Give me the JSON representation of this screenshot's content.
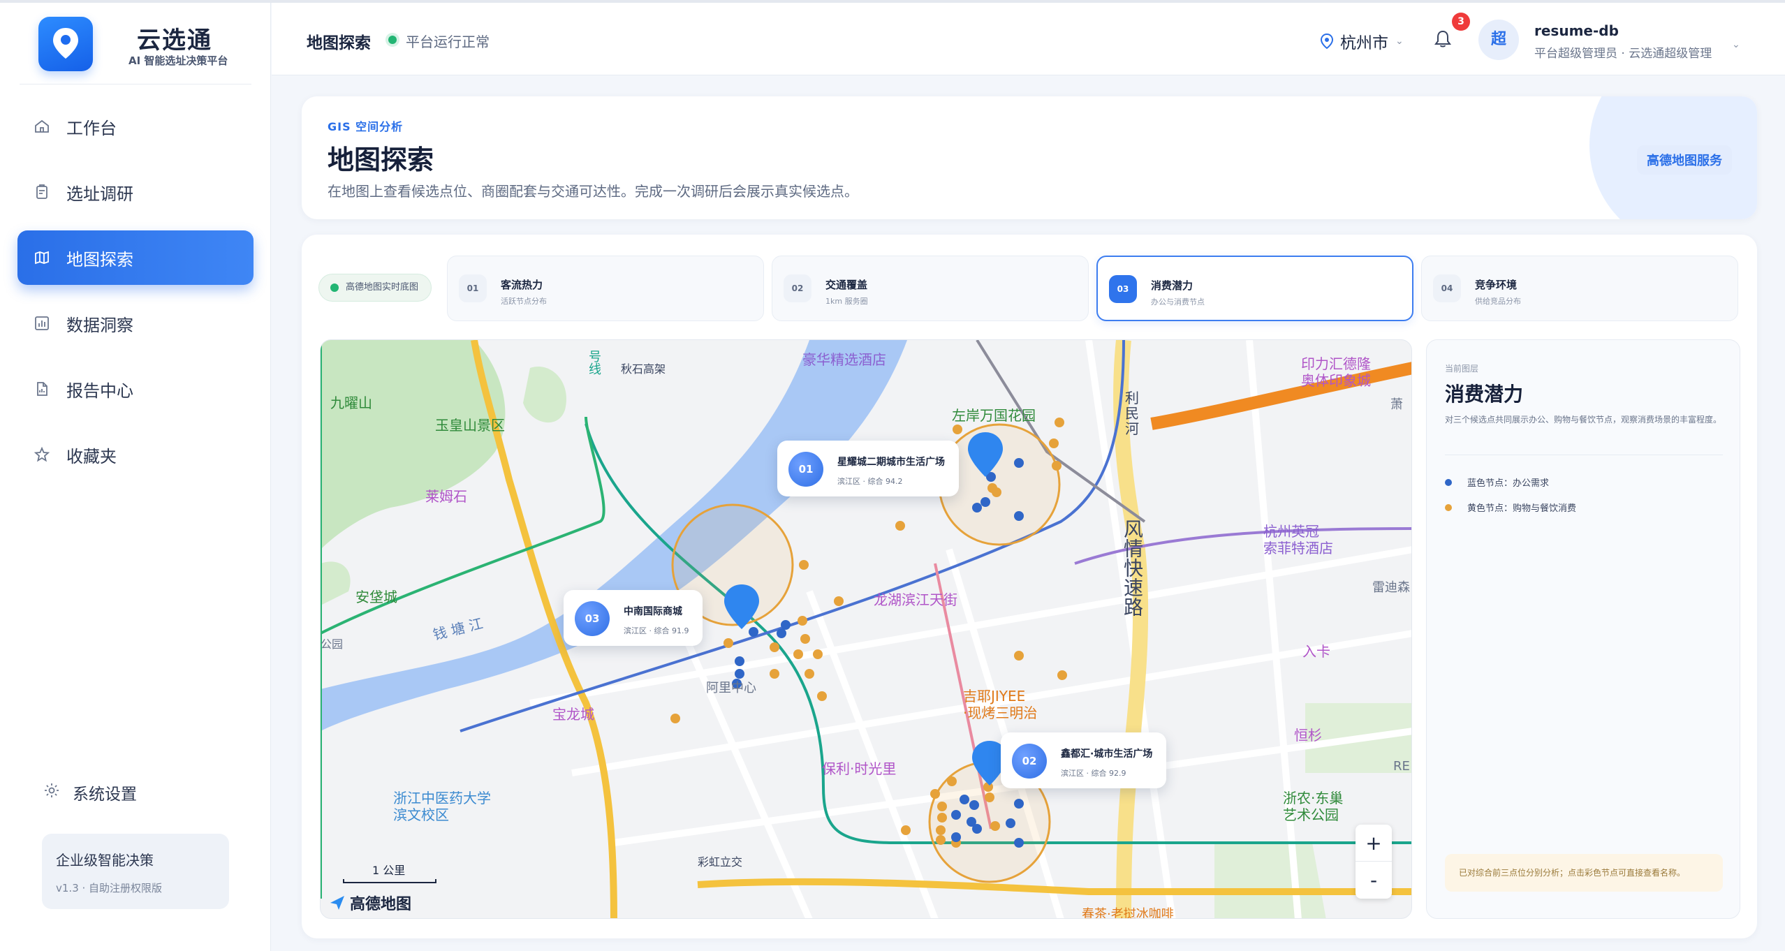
{
  "brand": {
    "name": "云选通",
    "tagline": "AI 智能选址决策平台"
  },
  "sidebar": {
    "items": [
      {
        "label": "工作台",
        "icon": "home-icon",
        "active": false
      },
      {
        "label": "选址调研",
        "icon": "clipboard-icon",
        "active": false
      },
      {
        "label": "地图探索",
        "icon": "map-icon",
        "active": true
      },
      {
        "label": "数据洞察",
        "icon": "bar-chart-icon",
        "active": false
      },
      {
        "label": "报告中心",
        "icon": "document-icon",
        "active": false
      },
      {
        "label": "收藏夹",
        "icon": "star-icon",
        "active": false
      }
    ],
    "settings_label": "系统设置",
    "enterprise": {
      "title": "企业级智能决策",
      "sub": "v1.3 · 自助注册权限版"
    }
  },
  "header": {
    "title": "地图探索",
    "status": "平台运行正常",
    "city": "杭州市",
    "notifications": "3",
    "avatar_text": "超",
    "user_name": "resume-db",
    "user_role": "平台超级管理员 · 云选通超级管理"
  },
  "hero": {
    "kicker": "GIS 空间分析",
    "title": "地图探索",
    "description": "在地图上查看候选点位、商圈配套与交通可达性。完成一次调研后会展示真实候选点。",
    "tag": "高德地图服务"
  },
  "panel": {
    "live_chip": "高德地图实时底图",
    "steps": [
      {
        "num": "01",
        "title": "客流热力",
        "sub": "活跃节点分布",
        "active": false
      },
      {
        "num": "02",
        "title": "交通覆盖",
        "sub": "1km 服务圈",
        "active": false
      },
      {
        "num": "03",
        "title": "消费潜力",
        "sub": "办公与消费节点",
        "active": true
      },
      {
        "num": "04",
        "title": "竞争环境",
        "sub": "供给竞品分布",
        "active": false
      }
    ]
  },
  "map": {
    "candidates": [
      {
        "num": "01",
        "name": "星耀城二期城市生活广场",
        "sub": "滨江区 · 综合 94.2"
      },
      {
        "num": "03",
        "name": "中南国际商城",
        "sub": "滨江区 · 综合 91.9"
      },
      {
        "num": "02",
        "name": "鑫都汇·城市生活广场",
        "sub": "滨江区 · 综合 92.9"
      }
    ],
    "labels": {
      "river": "钱 塘 江",
      "line": "号线",
      "road1": "秋石高架",
      "hotel": "豪华精选酒店",
      "yinli": "印力汇德隆",
      "yinli2": "奥体印象城",
      "xiao": "萧",
      "jiuyao": "九曜山",
      "yuhuang": "玉皇山景区",
      "zuoan": "左岸万国花园",
      "limin1": "利",
      "limin2": "民",
      "limin3": "河",
      "laimu": "莱姆石",
      "fengqing": "风情快速路",
      "hangzhou_ying1": "杭州英冠",
      "hangzhou_ying2": "索菲特酒店",
      "anjie": "安垡城",
      "longhu": "龙湖滨江天街",
      "leidi": "雷迪森",
      "park": "公园",
      "ruka": "入卡",
      "ali": "阿里中心",
      "jiye1": "吉耶JIYEE",
      "jiye2": "·现烤三明治",
      "baolong": "宝龙城",
      "henshan": "恒杉",
      "baoli": "保利·时光里",
      "re": "RE",
      "zhongyi1": "浙江中医药大学",
      "zhongyi2": "滨文校区",
      "caihong": "彩虹立交",
      "zhenong1": "浙农·东巢",
      "zhenong2": "艺术公园",
      "chunzhe": "春茶·老挝冰咖啡"
    },
    "scale_label": "1 公里",
    "logo_text": "高德地图",
    "zoom_in": "+",
    "zoom_out": "-"
  },
  "layer": {
    "kicker": "当前图层",
    "title": "消费潜力",
    "description": "对三个候选点共同展示办公、购物与餐饮节点，观察消费场景的丰富程度。",
    "legend": [
      {
        "label": "蓝色节点：办公需求",
        "color": "#2f66c7"
      },
      {
        "label": "黄色节点：购物与餐饮消费",
        "color": "#e6a23a"
      }
    ],
    "note": "已对综合前三点位分别分析；点击彩色节点可直接查看名称。"
  }
}
